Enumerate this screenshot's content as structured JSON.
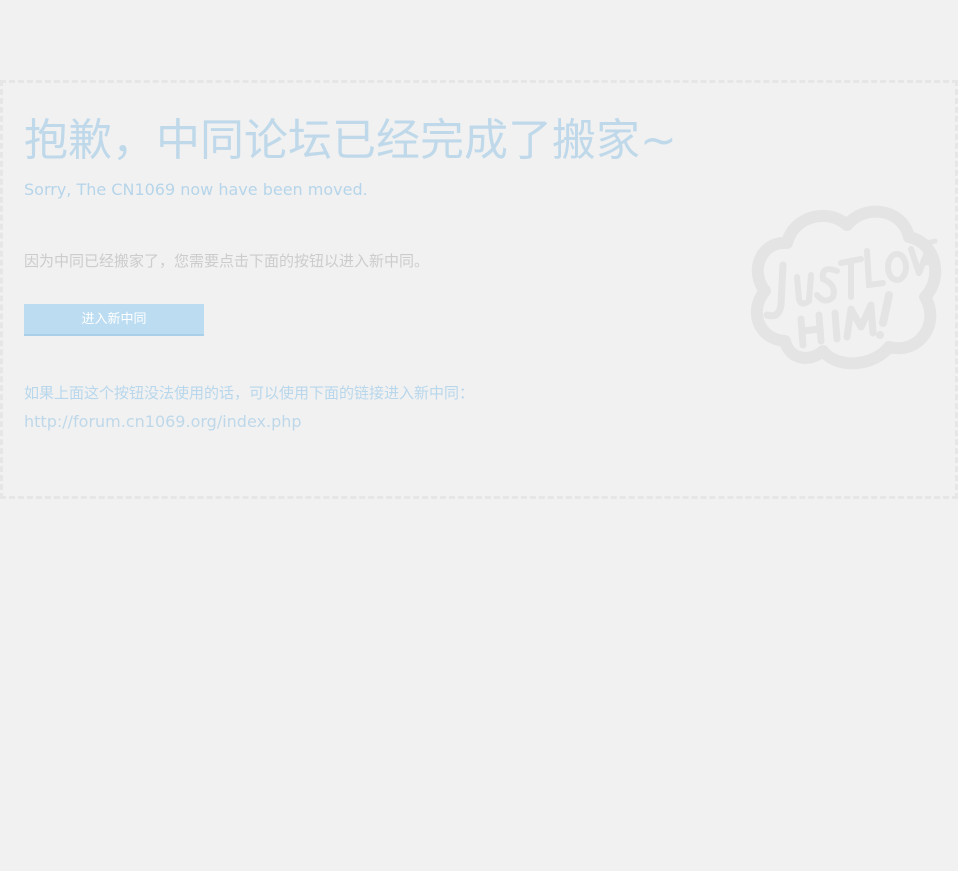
{
  "notice": {
    "title": "抱歉，中同论坛已经完成了搬家~",
    "subtitle": "Sorry, The CN1069 now have been moved.",
    "description": "因为中同已经搬家了，您需要点击下面的按钮以进入新中同。",
    "button_label": "进入新中同",
    "fallback_text": "如果上面这个按钮没法使用的话，可以使用下面的链接进入新中同：",
    "link_text": "http://forum.cn1069.org/index.php"
  },
  "colors": {
    "background": "#f1f1f1",
    "accent": "#bcdcf1",
    "title": "#bfd9ea",
    "muted_text": "#cccccc"
  },
  "icons": {
    "badge": "just-love-him-cloud-logo"
  }
}
